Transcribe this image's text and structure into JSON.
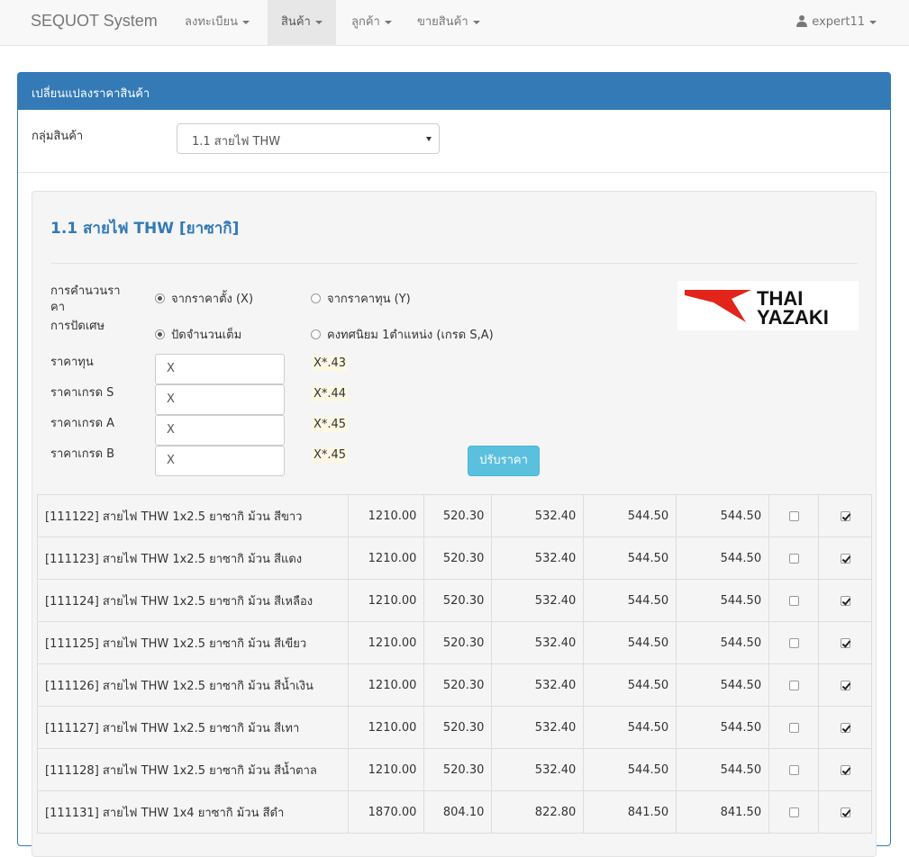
{
  "navbar": {
    "brand": "SEQUOT System",
    "items": [
      {
        "label": "ลงทะเบียน"
      },
      {
        "label": "สินค้า"
      },
      {
        "label": "ลูกค้า"
      },
      {
        "label": "ขายสินค้า"
      }
    ],
    "user": "expert11"
  },
  "panel": {
    "title": "เปลี่ยนแปลงราคาสินค้า",
    "group_label": "กลุ่มสินค้า",
    "group_selected": "1.1 สายไฟ THW"
  },
  "section": {
    "title": "1.1 สายไฟ THW [ยาซากิ]",
    "calc_label_1": "การคำนวนรา",
    "calc_label_2": "คา",
    "calc_from_list": "จากราคาตั้ง (X)",
    "calc_from_cost": "จากราคาทุน (Y)",
    "round_label": "การปัดเศษ",
    "round_integer": "ปัดจำนวนเต็ม",
    "round_decimal": "คงทศนิยม 1ตำแหน่ง (เกรด S,A)",
    "cost_label": "ราคาทุน",
    "grade_s_label": "ราคาเกรด S",
    "grade_a_label": "ราคาเกรด A",
    "grade_b_label": "ราคาเกรด B",
    "cost_value": "X",
    "grade_s_value": "X",
    "grade_a_value": "X",
    "grade_b_value": "X",
    "cost_formula": "X*.43",
    "grade_s_formula": "X*.44",
    "grade_a_formula": "X*.45",
    "grade_b_formula": "X*.45",
    "adjust_button": "ปรับราคา",
    "logo_line1": "THAI",
    "logo_line2": "YAZAKI"
  },
  "rows": [
    {
      "name": "[111122] สายไฟ THW 1x2.5 ยาซากิ ม้วน สีขาว",
      "list": "1210.00",
      "cost": "520.30",
      "s": "532.40",
      "a": "544.50",
      "b": "544.50",
      "c1": false,
      "c2": true
    },
    {
      "name": "[111123] สายไฟ THW 1x2.5 ยาซากิ ม้วน สีแดง",
      "list": "1210.00",
      "cost": "520.30",
      "s": "532.40",
      "a": "544.50",
      "b": "544.50",
      "c1": false,
      "c2": true
    },
    {
      "name": "[111124] สายไฟ THW 1x2.5 ยาซากิ ม้วน สีเหลือง",
      "list": "1210.00",
      "cost": "520.30",
      "s": "532.40",
      "a": "544.50",
      "b": "544.50",
      "c1": false,
      "c2": true
    },
    {
      "name": "[111125] สายไฟ THW 1x2.5 ยาซากิ ม้วน สีเขียว",
      "list": "1210.00",
      "cost": "520.30",
      "s": "532.40",
      "a": "544.50",
      "b": "544.50",
      "c1": false,
      "c2": true
    },
    {
      "name": "[111126] สายไฟ THW 1x2.5 ยาซากิ ม้วน สีน้ำเงิน",
      "list": "1210.00",
      "cost": "520.30",
      "s": "532.40",
      "a": "544.50",
      "b": "544.50",
      "c1": false,
      "c2": true
    },
    {
      "name": "[111127] สายไฟ THW 1x2.5 ยาซากิ ม้วน สีเทา",
      "list": "1210.00",
      "cost": "520.30",
      "s": "532.40",
      "a": "544.50",
      "b": "544.50",
      "c1": false,
      "c2": true
    },
    {
      "name": "[111128] สายไฟ THW 1x2.5 ยาซากิ ม้วน สีน้ำตาล",
      "list": "1210.00",
      "cost": "520.30",
      "s": "532.40",
      "a": "544.50",
      "b": "544.50",
      "c1": false,
      "c2": true
    },
    {
      "name": "[111131] สายไฟ THW 1x4 ยาซากิ ม้วน สีดำ",
      "list": "1870.00",
      "cost": "804.10",
      "s": "822.80",
      "a": "841.50",
      "b": "841.50",
      "c1": false,
      "c2": true
    }
  ]
}
